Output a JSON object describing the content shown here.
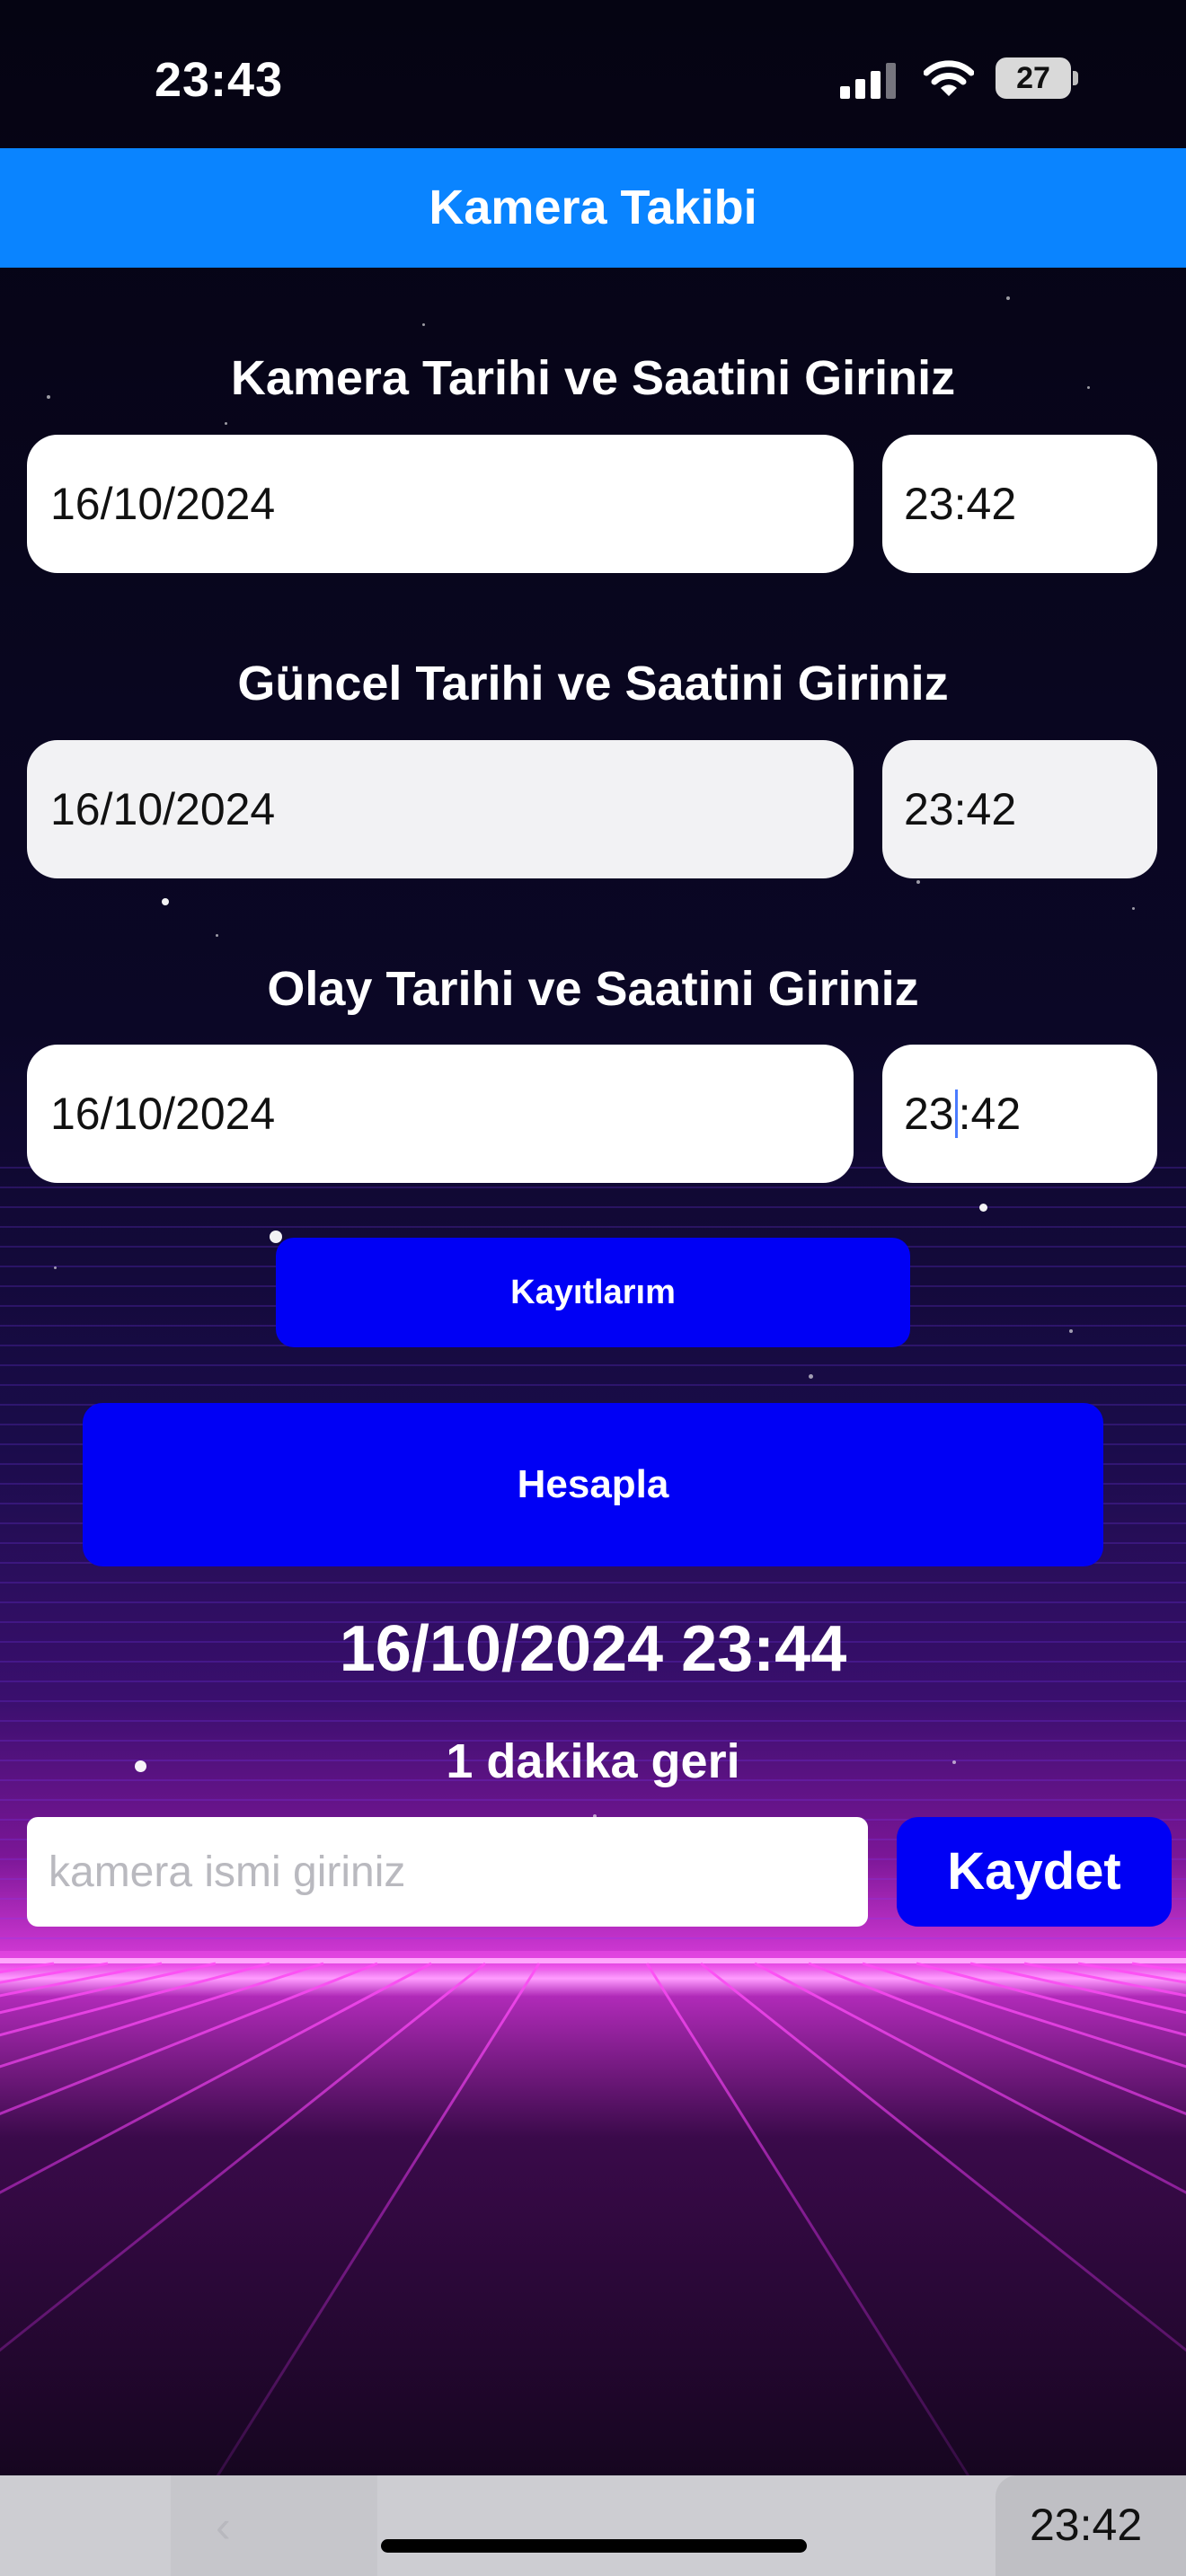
{
  "status_bar": {
    "time": "23:43",
    "battery": "27",
    "icons": [
      "signal-icon",
      "wifi-icon",
      "battery-icon"
    ]
  },
  "header": {
    "title": "Kamera Takibi"
  },
  "sections": [
    {
      "label": "Kamera Tarihi ve Saatini Giriniz",
      "date": "16/10/2024",
      "time": "23:42"
    },
    {
      "label": "Güncel Tarihi ve Saatini Giriniz",
      "date": "16/10/2024",
      "time": "23:42"
    },
    {
      "label": "Olay Tarihi ve Saatini Giriniz",
      "date": "16/10/2024",
      "time_before_caret": "23",
      "time_after_caret": ":42"
    }
  ],
  "buttons": {
    "records": "Kayıtlarım",
    "calculate": "Hesapla",
    "save": "Kaydet"
  },
  "result": {
    "datetime": "16/10/2024 23:44",
    "difference": "1 dakika geri"
  },
  "camera_name": {
    "placeholder": "kamera ismi giriniz",
    "value": ""
  },
  "bottom_bar": {
    "time": "23:42",
    "back_glyph": "‹"
  },
  "colors": {
    "header_bg": "#0a84ff",
    "button_bg": "#0000f5",
    "background": "#05040f",
    "neon_magenta": "#ff4df5"
  }
}
